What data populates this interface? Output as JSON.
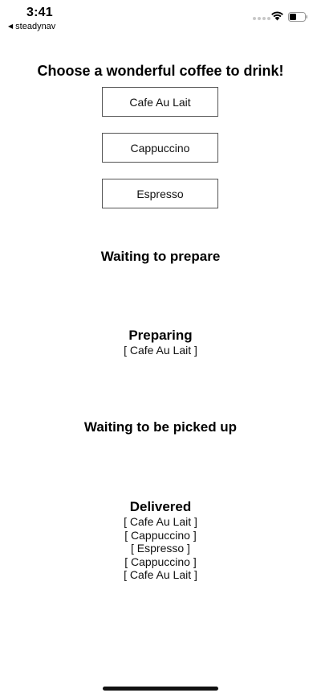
{
  "status_bar": {
    "time": "3:41",
    "back_app": "steadynav",
    "icons": [
      "signal-icon",
      "wifi-icon",
      "battery-icon"
    ]
  },
  "page": {
    "title": "Choose a wonderful coffee to drink!"
  },
  "coffee_buttons": [
    {
      "label": "Cafe Au Lait"
    },
    {
      "label": "Cappuccino"
    },
    {
      "label": "Espresso"
    }
  ],
  "sections": {
    "waiting_to_prepare": {
      "heading": "Waiting to prepare",
      "items": []
    },
    "preparing": {
      "heading": "Preparing",
      "items": [
        "[ Cafe Au Lait ]"
      ]
    },
    "waiting_pickup": {
      "heading": "Waiting to be picked up",
      "items": []
    },
    "delivered": {
      "heading": "Delivered",
      "items": [
        "[ Cafe Au Lait ]",
        "[ Cappuccino ]",
        "[ Espresso ]",
        "[ Cappuccino ]",
        "[ Cafe Au Lait ]"
      ]
    }
  },
  "colors": {
    "text": "#000000",
    "button_border": "#555555",
    "background": "#ffffff"
  }
}
